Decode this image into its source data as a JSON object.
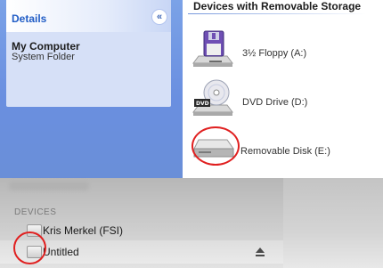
{
  "xp_explorer": {
    "details": {
      "title": "Details",
      "collapse_glyph": "«",
      "item_name": "My Computer",
      "item_type": "System Folder"
    },
    "group_title": "Devices with Removable Storage",
    "drives": [
      {
        "label": "3½ Floppy (A:)",
        "icon": "floppy-drive-icon"
      },
      {
        "label": "DVD Drive (D:)",
        "icon": "dvd-drive-icon"
      },
      {
        "label": "Removable Disk (E:)",
        "icon": "removable-disk-icon"
      }
    ],
    "colors": {
      "task_pane": "#6a8fe0",
      "details_bg": "#d6e0f7",
      "title_blue": "#215dc6"
    }
  },
  "mac_finder": {
    "devices_heading": "DEVICES",
    "items": [
      {
        "label": "Kris Merkel (FSI)",
        "icon": "disk-icon"
      },
      {
        "label": "Untitled",
        "icon": "disk-icon",
        "eject": "eject-icon"
      }
    ]
  },
  "annotations": {
    "circle_color": "#e02020"
  }
}
